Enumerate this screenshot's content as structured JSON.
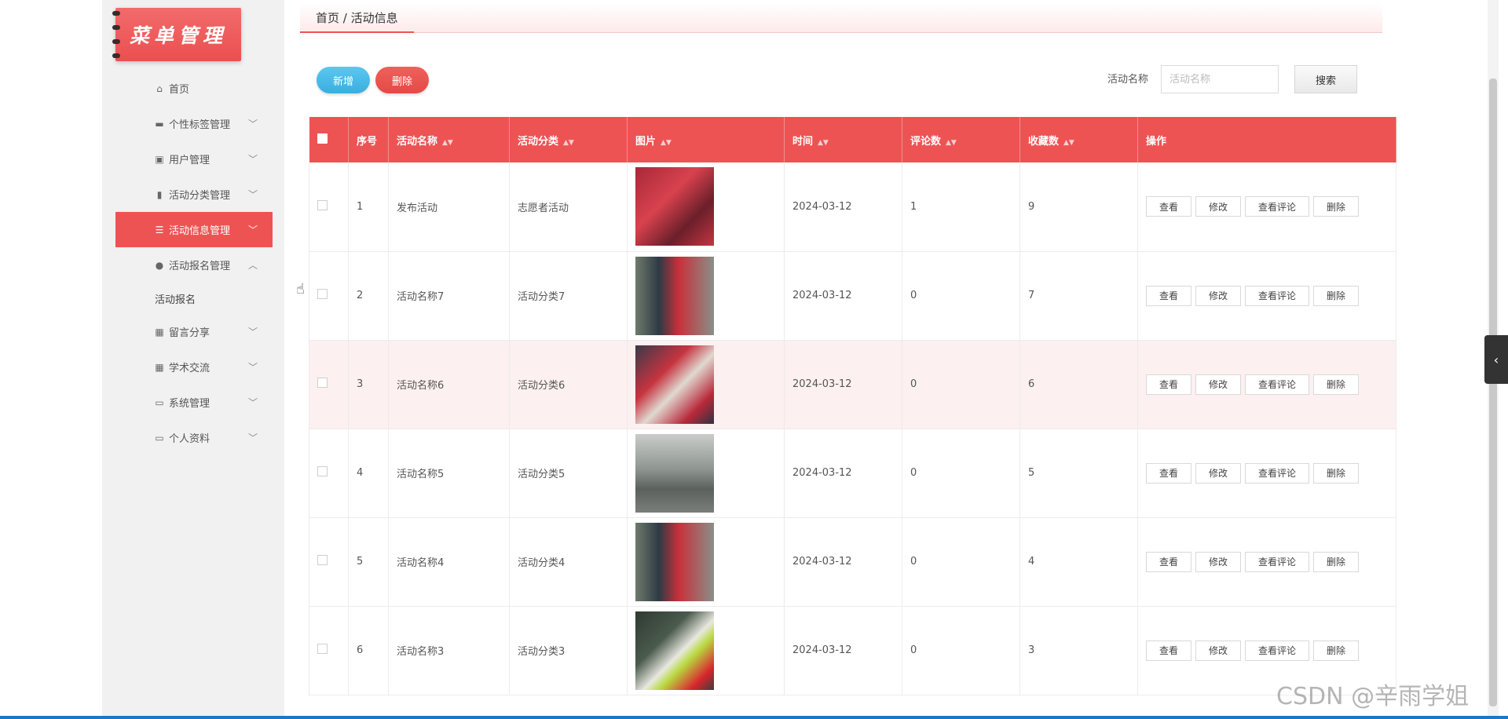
{
  "sidebar": {
    "logo_text": "菜单管理",
    "items": [
      {
        "label": "首页",
        "icon": "home-icon",
        "glyph": "⌂",
        "chevron": ""
      },
      {
        "label": "个性标签管理",
        "icon": "monitor-icon",
        "glyph": "▬",
        "chevron": "﹀"
      },
      {
        "label": "用户管理",
        "icon": "clipboard-icon",
        "glyph": "▣",
        "chevron": "﹀"
      },
      {
        "label": "活动分类管理",
        "icon": "chart-icon",
        "glyph": "▮",
        "chevron": "﹀"
      },
      {
        "label": "活动信息管理",
        "icon": "list-icon",
        "glyph": "☰",
        "chevron": "﹀",
        "active": true
      },
      {
        "label": "活动报名管理",
        "icon": "pin-icon",
        "glyph": "●",
        "chevron": "︿"
      },
      {
        "label": "留言分享",
        "icon": "grid-icon",
        "glyph": "▦",
        "chevron": "﹀"
      },
      {
        "label": "学术交流",
        "icon": "apps-icon",
        "glyph": "▦",
        "chevron": "﹀"
      },
      {
        "label": "系统管理",
        "icon": "briefcase-icon",
        "glyph": "▭",
        "chevron": "﹀"
      },
      {
        "label": "个人资料",
        "icon": "card-icon",
        "glyph": "▭",
        "chevron": "﹀"
      }
    ],
    "submenu_label": "活动报名"
  },
  "breadcrumb": "首页 / 活动信息",
  "toolbar": {
    "add_label": "新增",
    "delete_label": "删除"
  },
  "search": {
    "label": "活动名称",
    "placeholder": "活动名称",
    "button_label": "搜索"
  },
  "table": {
    "headers": [
      "序号",
      "活动名称",
      "活动分类",
      "图片",
      "时间",
      "评论数",
      "收藏数",
      "操作"
    ],
    "rows": [
      {
        "no": "1",
        "name": "发布活动",
        "category": "志愿者活动",
        "date": "2024-03-12",
        "comments": "1",
        "favorites": "9"
      },
      {
        "no": "2",
        "name": "活动名称7",
        "category": "活动分类7",
        "date": "2024-03-12",
        "comments": "0",
        "favorites": "7"
      },
      {
        "no": "3",
        "name": "活动名称6",
        "category": "活动分类6",
        "date": "2024-03-12",
        "comments": "0",
        "favorites": "6"
      },
      {
        "no": "4",
        "name": "活动名称5",
        "category": "活动分类5",
        "date": "2024-03-12",
        "comments": "0",
        "favorites": "5"
      },
      {
        "no": "5",
        "name": "活动名称4",
        "category": "活动分类4",
        "date": "2024-03-12",
        "comments": "0",
        "favorites": "4"
      },
      {
        "no": "6",
        "name": "活动名称3",
        "category": "活动分类3",
        "date": "2024-03-12",
        "comments": "0",
        "favorites": "3"
      }
    ],
    "actions": [
      "查看",
      "修改",
      "查看评论",
      "删除"
    ]
  },
  "watermark": "CSDN @辛雨学姐",
  "colors": {
    "accent": "#ee5354",
    "add_button": "#3aaee0",
    "delete_button": "#e34a45"
  }
}
